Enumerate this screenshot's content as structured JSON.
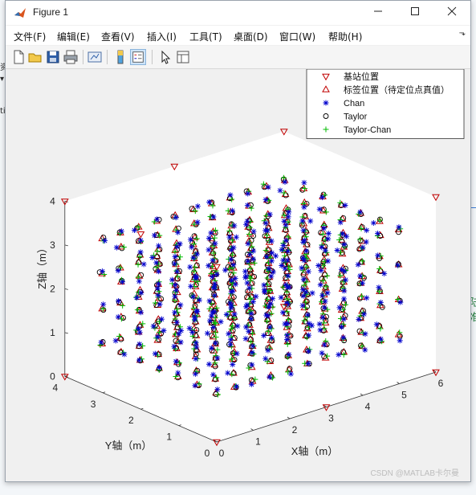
{
  "window": {
    "title": "Figure 1"
  },
  "menu": {
    "items": [
      "文件(F)",
      "编辑(E)",
      "查看(V)",
      "插入(I)",
      "工具(T)",
      "桌面(D)",
      "窗口(W)",
      "帮助(H)"
    ]
  },
  "toolbar": {
    "tools": [
      "new-figure",
      "open-file",
      "save",
      "print",
      "link-plot",
      "insert-colorbar",
      "insert-legend",
      "edit-plot",
      "property-inspector"
    ]
  },
  "chart_data": {
    "type": "scatter3d",
    "xlabel": "X轴（m）",
    "ylabel": "Y轴（m）",
    "zlabel": "Z轴（m）",
    "xticks": [
      "0",
      "1",
      "2",
      "3",
      "4",
      "5",
      "6"
    ],
    "yticks": [
      "0",
      "1",
      "2",
      "3",
      "4"
    ],
    "zticks": [
      "0",
      "1",
      "2",
      "3",
      "4"
    ],
    "xlim": [
      0,
      6
    ],
    "ylim": [
      0,
      4
    ],
    "zlim": [
      0,
      4
    ],
    "grid": false,
    "legend_position": "top-right",
    "legend": [
      {
        "label": "基站位置",
        "marker": "triangle-down",
        "color": "#c00000"
      },
      {
        "label": "标签位置（待定位点真值）",
        "marker": "triangle-up",
        "color": "#c00000"
      },
      {
        "label": "Chan",
        "marker": "asterisk",
        "color": "#0000cc"
      },
      {
        "label": "Taylor",
        "marker": "circle",
        "color": "#000000"
      },
      {
        "label": "Taylor-Chan",
        "marker": "plus",
        "color": "#00bb00"
      }
    ],
    "base_stations": [
      [
        0,
        0,
        0
      ],
      [
        6,
        0,
        0
      ],
      [
        0,
        4,
        0
      ],
      [
        6,
        4,
        0
      ],
      [
        0,
        0,
        4
      ],
      [
        6,
        0,
        4
      ],
      [
        0,
        4,
        4
      ],
      [
        6,
        4,
        4
      ],
      [
        3,
        0,
        0
      ],
      [
        0,
        2,
        4
      ],
      [
        3,
        4,
        4
      ]
    ],
    "tag_grid": {
      "x_from": 0.5,
      "x_to": 5.5,
      "x_step": 0.5,
      "y_from": 0.5,
      "y_to": 3.5,
      "y_step": 0.5,
      "z": [
        0.8,
        1.6,
        2.4,
        3.2
      ]
    }
  }
}
